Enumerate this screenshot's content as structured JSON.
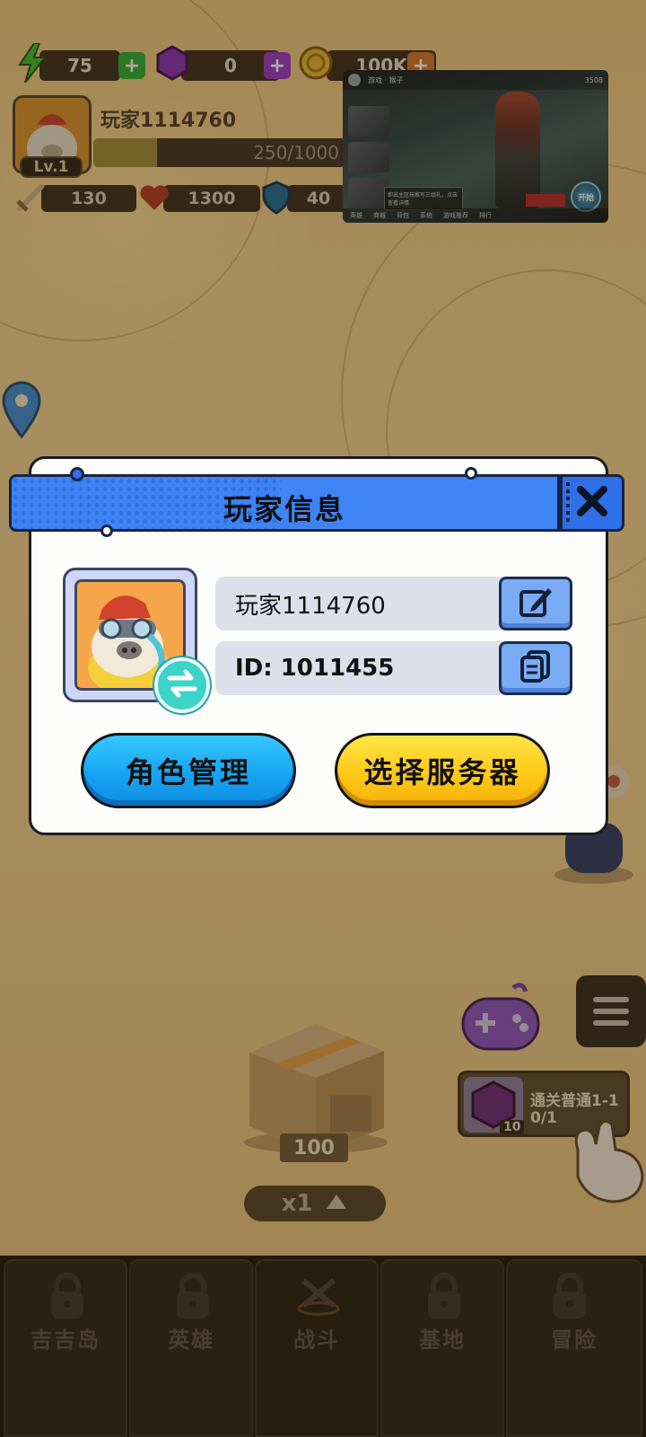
{
  "hud": {
    "energy": "75",
    "gems": "0",
    "gold": "100K",
    "player_name": "玩家1114760",
    "level": "Lv.1",
    "xp_text": "250/1000",
    "xp_fraction": 0.25,
    "attack": "130",
    "hp": "1300",
    "defense": "40"
  },
  "pip": {
    "top_name": "游戏 · 猴子",
    "coins": "3508",
    "message": "即出主区玩家写三组礼，点击查看详情",
    "tabs": [
      "英雄",
      "商城",
      "背包",
      "系统",
      "游戏推荐",
      "排行"
    ],
    "start_label": "开始"
  },
  "world": {
    "chest_count": "100",
    "speed": "x1",
    "quest_title": "通关普通1-1",
    "quest_progress": "0/1",
    "quest_reward_count": "10"
  },
  "nav": {
    "items": [
      {
        "label": "吉吉岛",
        "locked": true
      },
      {
        "label": "英雄",
        "locked": true
      },
      {
        "label": "战斗",
        "locked": false
      },
      {
        "label": "基地",
        "locked": true
      },
      {
        "label": "冒险",
        "locked": true
      }
    ]
  },
  "modal": {
    "title": "玩家信息",
    "name_value": "玩家1114760",
    "id_value": "ID: 1011455",
    "role_button": "角色管理",
    "server_button": "选择服务器"
  },
  "colors": {
    "header_blue": "#3f84f5",
    "btn_blue": "#16a5f3",
    "btn_yellow": "#ffc916",
    "swap_teal": "#3dd3c8"
  }
}
